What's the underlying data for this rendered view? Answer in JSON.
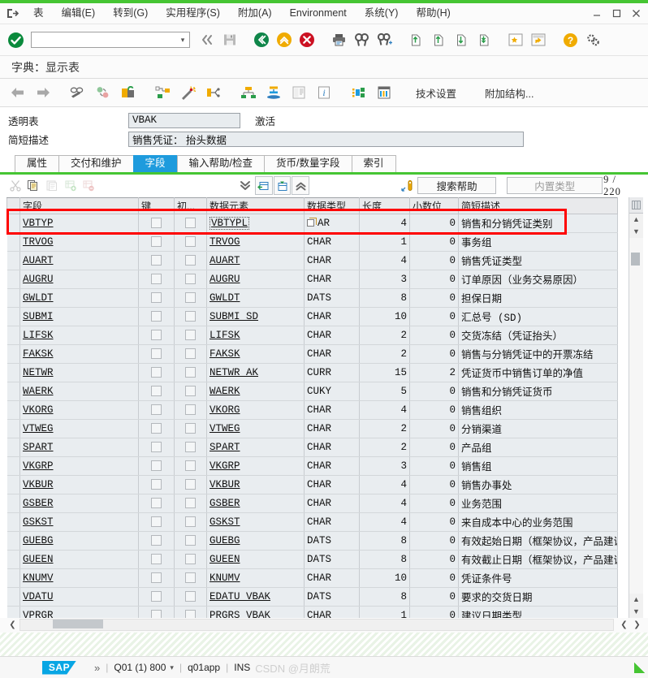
{
  "menubar": {
    "exit_icon": "exit-icon",
    "items": [
      {
        "label": "表",
        "accel": ""
      },
      {
        "label": "编辑(E)",
        "accel": "E"
      },
      {
        "label": "转到(G)",
        "accel": "G"
      },
      {
        "label": "实用程序(S)",
        "accel": "S"
      },
      {
        "label": "附加(A)",
        "accel": "A"
      },
      {
        "label": "Environment",
        "accel": ""
      },
      {
        "label": "系统(Y)",
        "accel": "Y"
      },
      {
        "label": "帮助(H)",
        "accel": "H"
      }
    ],
    "window_buttons": [
      "minimize",
      "maximize",
      "close"
    ]
  },
  "toolbar": {
    "ok_icon": "enter-green-check-icon",
    "command_field_value": "",
    "command_field_placeholder": "",
    "icons": [
      "back-double-arrow-icon",
      "save-disk-icon",
      "back-green-icon",
      "exit-yellow-up-icon",
      "cancel-red-icon",
      "print-icon",
      "find-icon",
      "find-next-icon",
      "first-page-icon",
      "previous-page-icon",
      "next-page-icon",
      "last-page-icon",
      "create-favorite-icon",
      "new-window-icon",
      "help-icon",
      "customize-local-layout-icon"
    ]
  },
  "title": {
    "text": "字典：显示表"
  },
  "apptoolbar": {
    "icons": [
      "back-arrow-icon",
      "forward-arrow-icon",
      "display-change-icon",
      "revert-icon",
      "unlock-activate-icon",
      "hierarchy-display-icon",
      "wizard-magic-icon",
      "where-used-list-icon",
      "structure-network-icon",
      "database-utility-icon",
      "documentation-icon",
      "information-icon",
      "runtime-object-icon",
      "table-contents-icon"
    ],
    "buttons": [
      {
        "label": "技术设置"
      },
      {
        "label": "附加结构..."
      }
    ]
  },
  "header": {
    "rows": [
      {
        "label": "透明表",
        "value": "VBAK",
        "status": "激活"
      },
      {
        "label": "简短描述",
        "value": "销售凭证： 抬头数据",
        "status": ""
      }
    ]
  },
  "tabs": [
    {
      "label": "属性",
      "active": false
    },
    {
      "label": "交付和维护",
      "active": false
    },
    {
      "label": "字段",
      "active": true
    },
    {
      "label": "输入帮助/检查",
      "active": false
    },
    {
      "label": "货币/数量字段",
      "active": false
    },
    {
      "label": "索引",
      "active": false
    }
  ],
  "gridtoolbar": {
    "icons": [
      "cut-icon",
      "copy-icon",
      "paste-icon",
      "insert-row-icon",
      "delete-row-icon",
      "scroll-bottom-icon",
      "append-row-icon",
      "insert-row-above-icon",
      "scroll-top-icon",
      "srch-help-key-icon"
    ],
    "search_help_button": "搜索帮助",
    "builtin_type_button": "内置类型",
    "counter_current": "9",
    "counter_separator": "/",
    "counter_total": "220"
  },
  "grid": {
    "columns": [
      {
        "key": "field",
        "label": "字段"
      },
      {
        "key": "keyflag",
        "label": "键"
      },
      {
        "key": "initial",
        "label": "初..."
      },
      {
        "key": "dataelement",
        "label": "数据元素"
      },
      {
        "key": "datatype",
        "label": "数据类型"
      },
      {
        "key": "length",
        "label": "长度"
      },
      {
        "key": "decimals",
        "label": "小数位"
      },
      {
        "key": "description",
        "label": "简短描述"
      }
    ],
    "rows": [
      {
        "field": "VBTYP",
        "key": false,
        "initial": false,
        "dataelement": "VBTYPL",
        "datatype": "AR",
        "datatype_icon": "value-help-icon",
        "length": "4",
        "decimals": "0",
        "description": "销售和分销凭证类别",
        "highlighted": true
      },
      {
        "field": "TRVOG",
        "key": false,
        "initial": false,
        "dataelement": "TRVOG",
        "datatype": "CHAR",
        "length": "1",
        "decimals": "0",
        "description": "事务组"
      },
      {
        "field": "AUART",
        "key": false,
        "initial": false,
        "dataelement": "AUART",
        "datatype": "CHAR",
        "length": "4",
        "decimals": "0",
        "description": "销售凭证类型"
      },
      {
        "field": "AUGRU",
        "key": false,
        "initial": false,
        "dataelement": "AUGRU",
        "datatype": "CHAR",
        "length": "3",
        "decimals": "0",
        "description": "订单原因（业务交易原因）"
      },
      {
        "field": "GWLDT",
        "key": false,
        "initial": false,
        "dataelement": "GWLDT",
        "datatype": "DATS",
        "length": "8",
        "decimals": "0",
        "description": "担保日期"
      },
      {
        "field": "SUBMI",
        "key": false,
        "initial": false,
        "dataelement": "SUBMI_SD",
        "datatype": "CHAR",
        "length": "10",
        "decimals": "0",
        "description": "汇总号 (SD)"
      },
      {
        "field": "LIFSK",
        "key": false,
        "initial": false,
        "dataelement": "LIFSK",
        "datatype": "CHAR",
        "length": "2",
        "decimals": "0",
        "description": "交货冻结（凭证抬头）"
      },
      {
        "field": "FAKSK",
        "key": false,
        "initial": false,
        "dataelement": "FAKSK",
        "datatype": "CHAR",
        "length": "2",
        "decimals": "0",
        "description": "销售与分销凭证中的开票冻结"
      },
      {
        "field": "NETWR",
        "key": false,
        "initial": false,
        "dataelement": "NETWR_AK",
        "datatype": "CURR",
        "length": "15",
        "decimals": "2",
        "description": "凭证货币中销售订单的净值"
      },
      {
        "field": "WAERK",
        "key": false,
        "initial": false,
        "dataelement": "WAERK",
        "datatype": "CUKY",
        "length": "5",
        "decimals": "0",
        "description": "销售和分销凭证货币"
      },
      {
        "field": "VKORG",
        "key": false,
        "initial": false,
        "dataelement": "VKORG",
        "datatype": "CHAR",
        "length": "4",
        "decimals": "0",
        "description": "销售组织"
      },
      {
        "field": "VTWEG",
        "key": false,
        "initial": false,
        "dataelement": "VTWEG",
        "datatype": "CHAR",
        "length": "2",
        "decimals": "0",
        "description": "分销渠道"
      },
      {
        "field": "SPART",
        "key": false,
        "initial": false,
        "dataelement": "SPART",
        "datatype": "CHAR",
        "length": "2",
        "decimals": "0",
        "description": "产品组"
      },
      {
        "field": "VKGRP",
        "key": false,
        "initial": false,
        "dataelement": "VKGRP",
        "datatype": "CHAR",
        "length": "3",
        "decimals": "0",
        "description": "销售组"
      },
      {
        "field": "VKBUR",
        "key": false,
        "initial": false,
        "dataelement": "VKBUR",
        "datatype": "CHAR",
        "length": "4",
        "decimals": "0",
        "description": "销售办事处"
      },
      {
        "field": "GSBER",
        "key": false,
        "initial": false,
        "dataelement": "GSBER",
        "datatype": "CHAR",
        "length": "4",
        "decimals": "0",
        "description": "业务范围"
      },
      {
        "field": "GSKST",
        "key": false,
        "initial": false,
        "dataelement": "GSKST",
        "datatype": "CHAR",
        "length": "4",
        "decimals": "0",
        "description": "来自成本中心的业务范围"
      },
      {
        "field": "GUEBG",
        "key": false,
        "initial": false,
        "dataelement": "GUEBG",
        "datatype": "DATS",
        "length": "8",
        "decimals": "0",
        "description": "有效起始日期（框架协议，产品建议）"
      },
      {
        "field": "GUEEN",
        "key": false,
        "initial": false,
        "dataelement": "GUEEN",
        "datatype": "DATS",
        "length": "8",
        "decimals": "0",
        "description": "有效截止日期（框架协议，产品建议）"
      },
      {
        "field": "KNUMV",
        "key": false,
        "initial": false,
        "dataelement": "KNUMV",
        "datatype": "CHAR",
        "length": "10",
        "decimals": "0",
        "description": "凭证条件号"
      },
      {
        "field": "VDATU",
        "key": false,
        "initial": false,
        "dataelement": "EDATU_VBAK",
        "datatype": "DATS",
        "length": "8",
        "decimals": "0",
        "description": "要求的交货日期"
      },
      {
        "field": "VPRGR",
        "key": false,
        "initial": false,
        "dataelement": "PRGRS_VBAK",
        "datatype": "CHAR",
        "length": "1",
        "decimals": "0",
        "description": "建议日期类型"
      }
    ]
  },
  "statusbar": {
    "logo": "SAP",
    "expand_icon": "status-expand-icon",
    "system": "Q01 (1) 800",
    "server": "q01app",
    "insert_mode": "INS",
    "watermark": "CSDN @月朗荒"
  },
  "colors": {
    "accent_green": "#46c533",
    "tab_active": "#1e9bdd",
    "highlight_red": "#ff0000",
    "sap_blue": "#08a6e4"
  }
}
